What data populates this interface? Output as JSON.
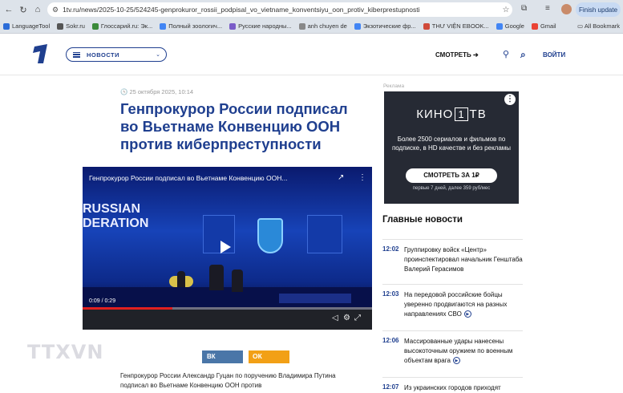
{
  "browser": {
    "url": "1tv.ru/news/2025-10-25/524245-genprokuror_rossii_podpisal_vo_vietname_konventsiyu_oon_protiv_kiberprestupnosti",
    "update_label": "Finish update",
    "bookmarks": [
      {
        "label": "LanguageTool",
        "color": "#2b6cd8"
      },
      {
        "label": "Sokr.ru",
        "color": "#555555"
      },
      {
        "label": "Глоссарий.ru: Эк...",
        "color": "#3a8a3a"
      },
      {
        "label": "Полный зоологич...",
        "color": "#4285f4"
      },
      {
        "label": "Русские народны...",
        "color": "#7a5cc8"
      },
      {
        "label": "anh chuyen de",
        "color": "#888888"
      },
      {
        "label": "Экзотические фр...",
        "color": "#4285f4"
      },
      {
        "label": "THƯ VIỆN EBOOK...",
        "color": "#d04a3a"
      },
      {
        "label": "Google",
        "color": "#4285f4"
      },
      {
        "label": "Gmail",
        "color": "#ea4335"
      }
    ],
    "all_bookmarks": "All Bookmark"
  },
  "header": {
    "menu_label": "НОВОСТИ",
    "watch_label": "СМОТРЕТЬ ➔",
    "login_label": "ВОЙТИ"
  },
  "article": {
    "date": "25 октября 2025, 10:14",
    "title": "Генпрокурор России подписал во Вьетнаме Конвенцию ООН против киберпреступности",
    "video_title": "Генпрокурор России подписал во Вьетнаме Конвенцию ООН...",
    "stage_text": "RUSSIAN\nDERATION",
    "video_time": "0:09 / 0:29",
    "video_progress": 0.31,
    "watermark": "TTXVN",
    "share_vk": "ВК",
    "share_ok": "ОК",
    "lead": "Генпрокурор России Александр Гуцан по поручению Владимира Путина подписал во Вьетнаме Конвенцию ООН против"
  },
  "ad": {
    "label": "Реклама",
    "brand_left": "КИНО",
    "brand_box": "1",
    "brand_right": "ТВ",
    "text": "Более 2500 сериалов и фильмов по подписке, в HD качестве и без рекламы",
    "button": "СМОТРЕТЬ ЗА 1₽",
    "small": "первые 7 дней, далее 359 руб/мес"
  },
  "main_news": {
    "title": "Главные новости",
    "items": [
      {
        "time": "12:02",
        "text": "Группировку войск «Центр» проинспектировал начальник Генштаба Валерий Герасимов"
      },
      {
        "time": "12:03",
        "text": "На передовой российские бойцы уверенно продвигаются на разных направлениях СВО"
      },
      {
        "time": "12:06",
        "text": "Массированные удары нанесены высокоточным оружием по военным объектам врага"
      },
      {
        "time": "12:07",
        "text": "Из украинских городов приходят"
      }
    ]
  },
  "colors": {
    "brand_blue": "#1f3f8f",
    "video_progress_red": "#e02020"
  }
}
